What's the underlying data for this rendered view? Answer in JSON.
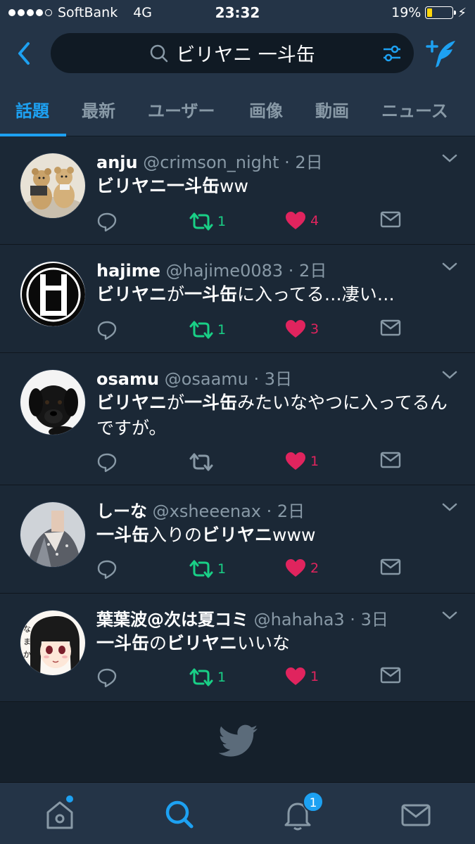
{
  "status": {
    "carrier": "SoftBank",
    "network": "4G",
    "time": "23:32",
    "battery": "19%",
    "battery_level": 0.19,
    "battery_color": "#ffd60a"
  },
  "search": {
    "query": "ビリヤニ 一斗缶"
  },
  "tabs": [
    {
      "label": "話題",
      "active": true
    },
    {
      "label": "最新"
    },
    {
      "label": "ユーザー"
    },
    {
      "label": "画像"
    },
    {
      "label": "動画"
    },
    {
      "label": "ニュース"
    }
  ],
  "tweets": [
    {
      "name": "anju",
      "handle": "@crimson_night",
      "time": "2日",
      "segments": [
        {
          "t": "ビリヤニ一斗缶",
          "b": true
        },
        {
          "t": "ww",
          "b": false
        }
      ],
      "retweets": "1",
      "likes": "4",
      "retweeted": true
    },
    {
      "name": "hajime",
      "handle": "@hajime0083",
      "time": "2日",
      "segments": [
        {
          "t": "ビリヤニ",
          "b": true
        },
        {
          "t": "が",
          "b": false
        },
        {
          "t": "一斗缶",
          "b": true
        },
        {
          "t": "に入ってる…凄い…",
          "b": false
        }
      ],
      "retweets": "1",
      "likes": "3",
      "retweeted": true
    },
    {
      "name": "osamu",
      "handle": "@osaamu",
      "time": "3日",
      "segments": [
        {
          "t": "ビリヤニ",
          "b": true
        },
        {
          "t": "が",
          "b": false
        },
        {
          "t": "一斗缶",
          "b": true
        },
        {
          "t": "みたいなやつに入ってるんですが。",
          "b": false
        }
      ],
      "retweets": "",
      "likes": "1",
      "retweeted": false
    },
    {
      "name": "しーな",
      "handle": "@xsheeenax",
      "time": "2日",
      "segments": [
        {
          "t": "一斗缶",
          "b": true
        },
        {
          "t": "入りの",
          "b": false
        },
        {
          "t": "ビリヤニ",
          "b": true
        },
        {
          "t": "www",
          "b": false
        }
      ],
      "retweets": "1",
      "likes": "2",
      "retweeted": true
    },
    {
      "name": "葉葉波@次は夏コミ",
      "handle": "@hahaha3",
      "time": "3日",
      "segments": [
        {
          "t": "一斗缶",
          "b": true
        },
        {
          "t": "の",
          "b": false
        },
        {
          "t": "ビリヤニ",
          "b": true
        },
        {
          "t": "いいな",
          "b": false
        }
      ],
      "retweets": "1",
      "likes": "1",
      "retweeted": true
    }
  ],
  "avatar_art": {
    "hajime_logo": "H U"
  },
  "tabbar": {
    "notification_badge": "1"
  },
  "colors": {
    "accent": "#1da1f2",
    "retweet": "#19cf86",
    "like": "#e0245e",
    "background": "#1b2836",
    "bar": "#243447"
  }
}
